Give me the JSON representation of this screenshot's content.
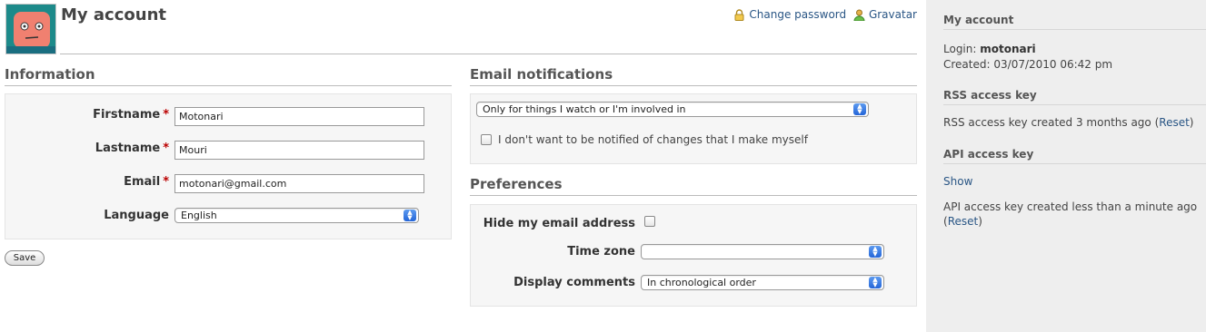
{
  "header": {
    "title": "My account",
    "change_password": "Change password",
    "gravatar": "Gravatar"
  },
  "information": {
    "heading": "Information",
    "firstname_label": "Firstname",
    "firstname_value": "Motonari",
    "lastname_label": "Lastname",
    "lastname_value": "Mouri",
    "email_label": "Email",
    "email_value": "motonari@gmail.com",
    "language_label": "Language",
    "language_value": "English",
    "required_mark": "*"
  },
  "save_label": "Save",
  "email_notifications": {
    "heading": "Email notifications",
    "selected": "Only for things I watch or I'm involved in",
    "no_self_notified_label": "I don't want to be notified of changes that I make myself",
    "no_self_notified_checked": false
  },
  "preferences": {
    "heading": "Preferences",
    "hide_email_label": "Hide my email address",
    "hide_email_checked": false,
    "time_zone_label": "Time zone",
    "time_zone_value": "",
    "display_comments_label": "Display comments",
    "display_comments_value": "In chronological order"
  },
  "sidebar": {
    "heading": "My account",
    "login_label": "Login:",
    "login_value": "motonari",
    "created_label": "Created:",
    "created_value": "03/07/2010 06:42 pm",
    "rss_heading": "RSS access key",
    "rss_text": "RSS access key created 3 months ago (",
    "rss_reset": "Reset",
    "rss_close": ")",
    "api_heading": "API access key",
    "api_show": "Show",
    "api_text_line1": "API access key created less than a minute ago",
    "api_text_line2_open": "(",
    "api_reset": "Reset",
    "api_close": ")"
  },
  "colors": {
    "link": "#2a5685",
    "required": "#bb0000",
    "sidebar_bg": "#eeeeee",
    "box_bg": "#f6f6f6"
  }
}
